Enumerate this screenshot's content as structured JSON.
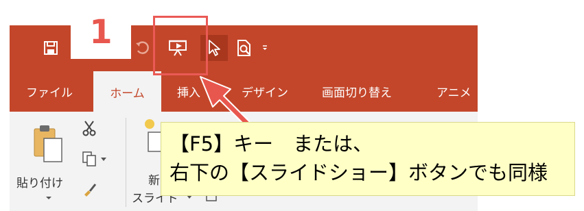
{
  "step_number": "1",
  "quick_access_toolbar": {
    "buttons": [
      {
        "name": "save",
        "icon": "save-icon"
      },
      {
        "name": "undo",
        "icon": "undo-icon"
      },
      {
        "name": "start-from-beginning",
        "icon": "slideshow-from-beginning-icon"
      },
      {
        "name": "touch-mouse-mode",
        "icon": "pointer-icon"
      },
      {
        "name": "print-preview",
        "icon": "print-preview-icon"
      },
      {
        "name": "customize",
        "icon": "chevron-down-icon"
      }
    ]
  },
  "ribbon_tabs": [
    "ファイル",
    "ホーム",
    "挿入",
    "デザイン",
    "画面切り替え",
    "アニメ"
  ],
  "active_tab": "ホーム",
  "ribbon": {
    "paste_label": "貼り付け",
    "new_slide_label_top": "新",
    "new_slide_label": "スライド"
  },
  "callout": {
    "line1": "【F5】キー　または、",
    "line2": "右下の【スライドショー】ボタンでも同様"
  },
  "colors": {
    "titlebar": "#c3462a",
    "highlight": "#ea5a55",
    "callout_bg": "#ffffc6",
    "step_number": "#e8574e"
  }
}
